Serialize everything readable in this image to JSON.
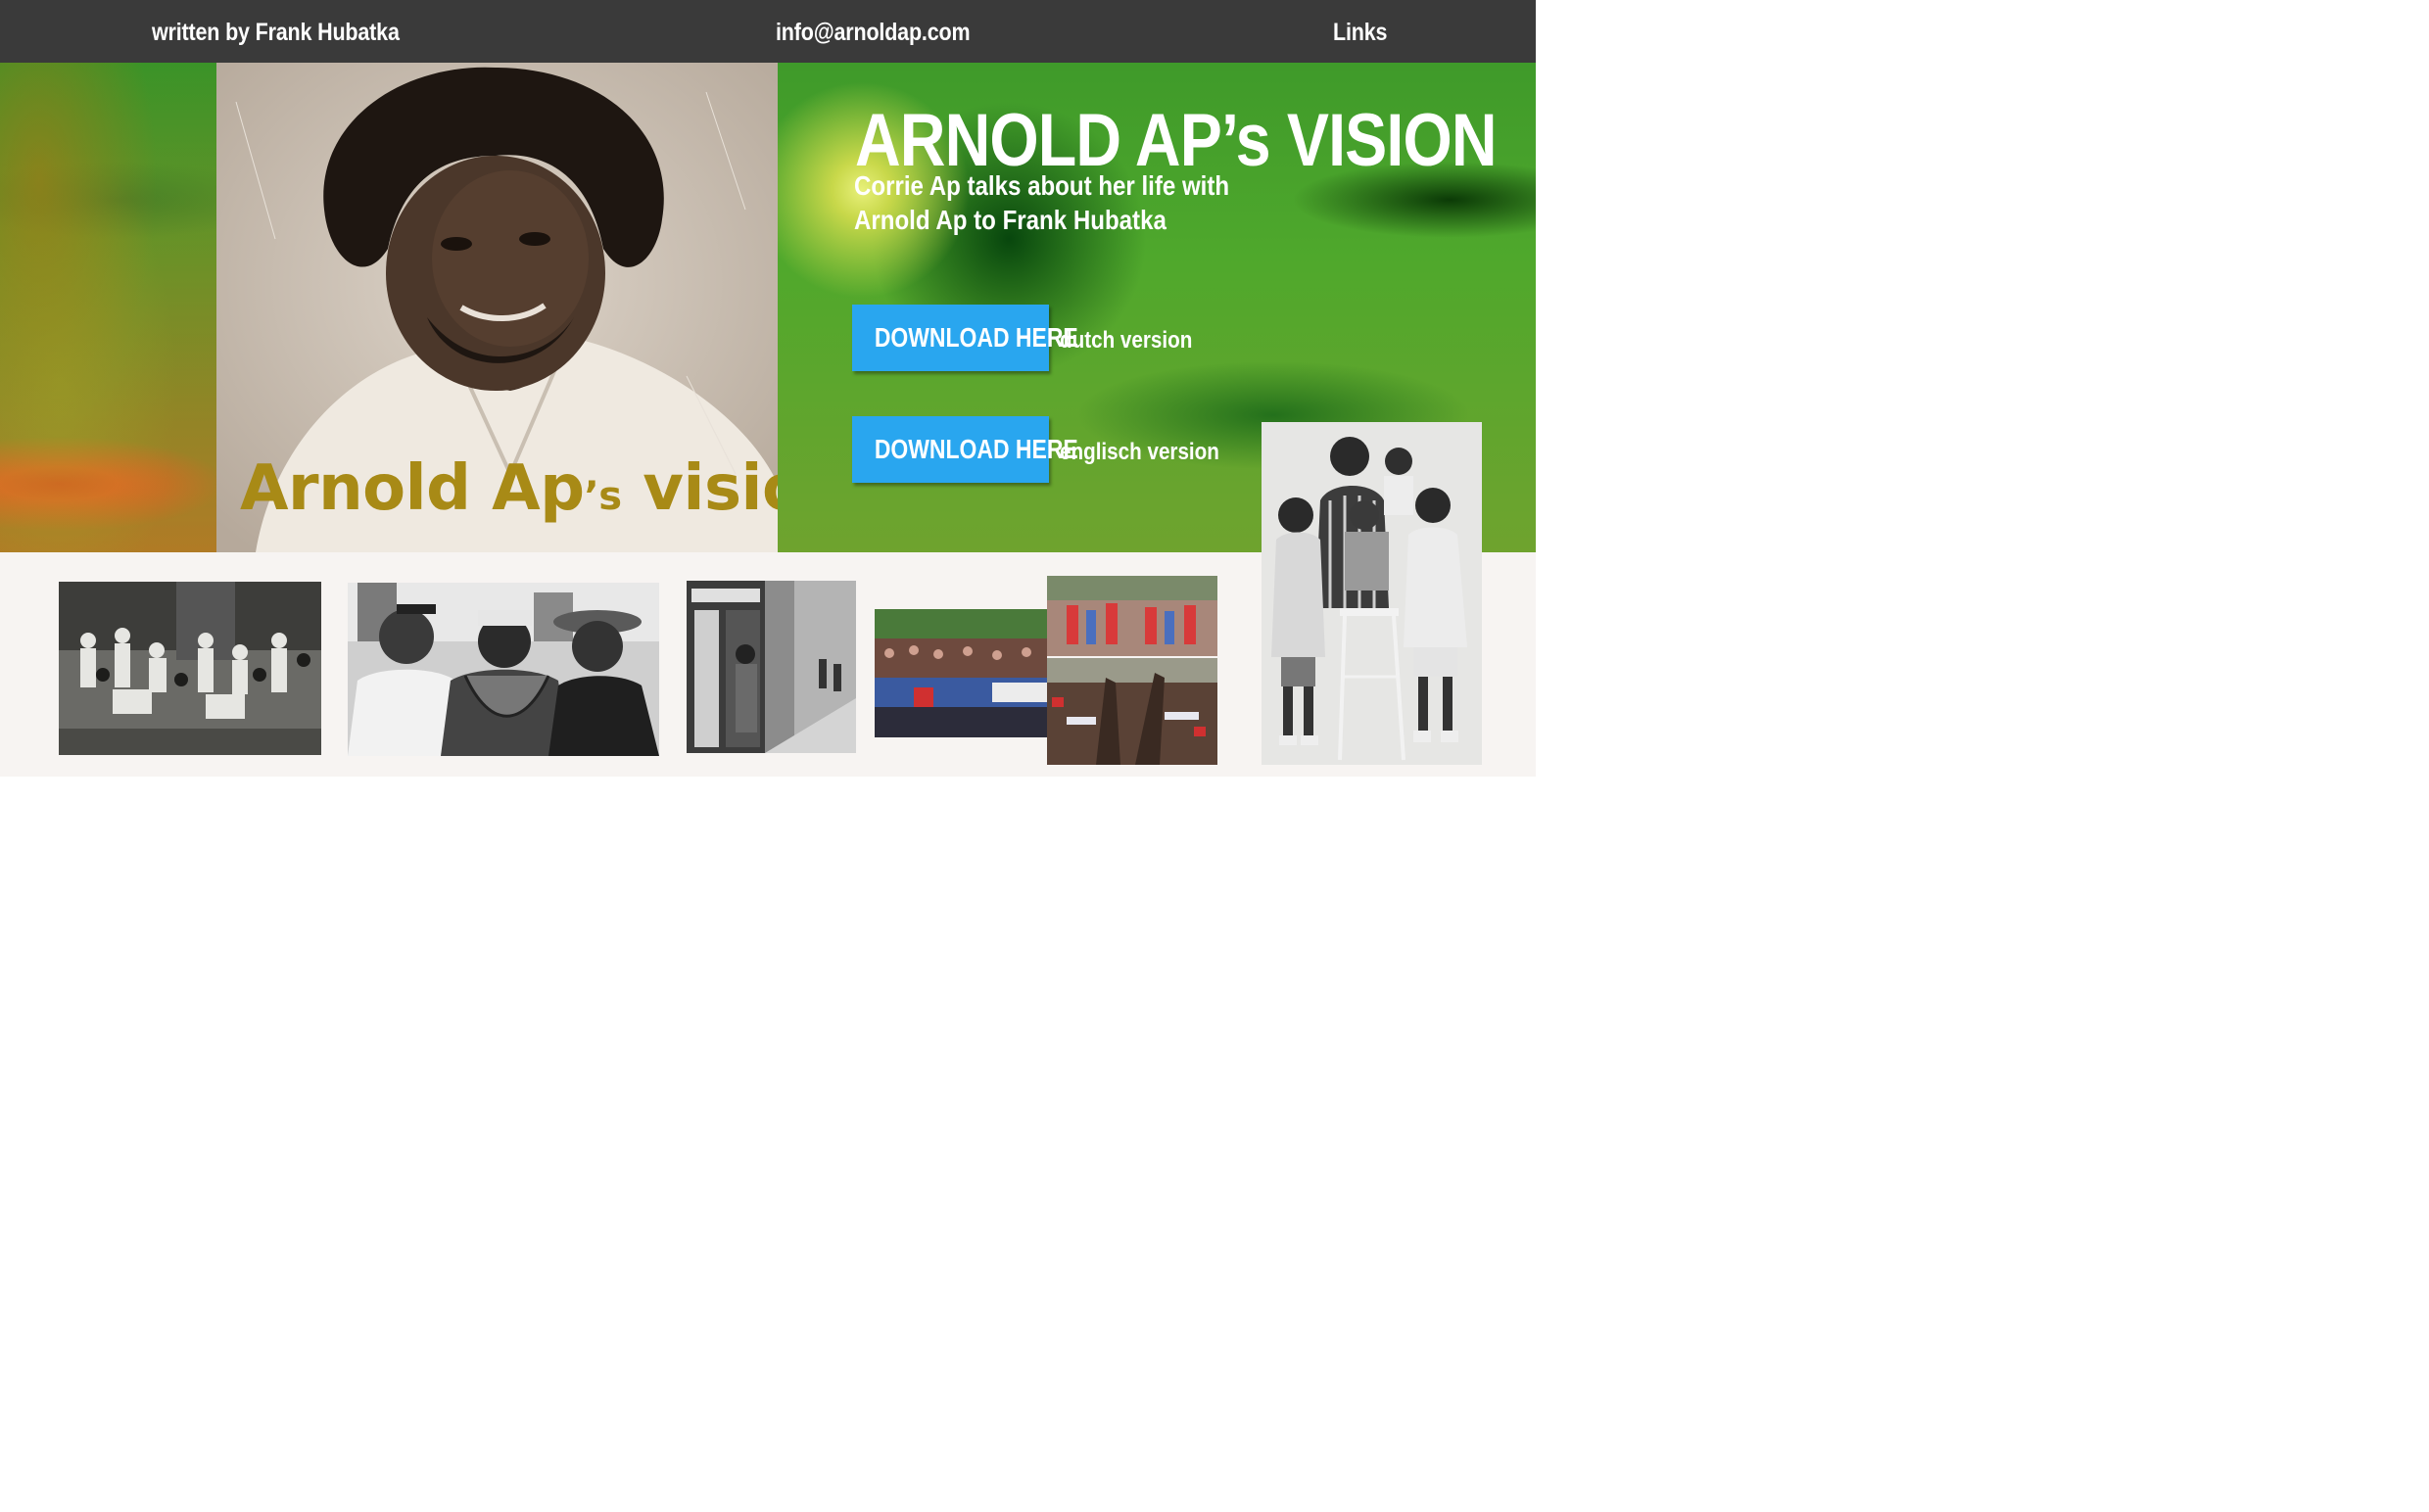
{
  "header": {
    "author": "written by Frank Hubatka",
    "email": "info@arnoldap.com",
    "links": "Links"
  },
  "hero": {
    "portrait_caption_main": "Arnold Ap",
    "portrait_caption_s": "’s",
    "portrait_caption_tail": " vision",
    "title": "ARNOLD AP’s VISION",
    "subtitle_line1": "Corrie Ap talks about her life with",
    "subtitle_line2": "Arnold Ap to Frank Hubatka",
    "downloads": [
      {
        "button": "DOWNLOAD HERE",
        "label": "dutch version"
      },
      {
        "button": "DOWNLOAD HERE",
        "label": "englisch version"
      }
    ]
  },
  "colors": {
    "header_bg": "#3a3a3a",
    "button_bg": "#29a6ef",
    "caption_gold": "#a88a16",
    "strip_bg": "#f7f4f2"
  }
}
